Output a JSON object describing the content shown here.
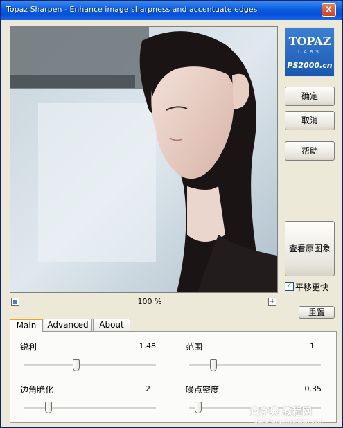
{
  "window": {
    "title": "Topaz Sharpen - Enhance image sharpness and accentuate edges",
    "close_label": "x"
  },
  "logo": {
    "main": "TOPAZ",
    "sub": "LABS",
    "site": "PS2000.cn"
  },
  "buttons": {
    "ok": "确定",
    "cancel": "取消",
    "help": "帮助",
    "view_original": "查看原图象",
    "reset": "重置"
  },
  "pan": {
    "label": "平移更快",
    "checked": true
  },
  "zoom": {
    "level": "100 %",
    "plus": "+"
  },
  "tabs": [
    "Main",
    "Advanced",
    "About"
  ],
  "params": [
    {
      "label": "锐利",
      "value": "1.48",
      "level": 0.37
    },
    {
      "label": "范围",
      "value": "1",
      "level": 0.16
    },
    {
      "label": "边角脆化",
      "value": "2",
      "level": 0.16
    },
    {
      "label": "噪点密度",
      "value": "0.35",
      "level": 0.04
    }
  ],
  "watermark": {
    "text": "查字典 教程网",
    "url": "jiaocheng.chazidian.com"
  }
}
